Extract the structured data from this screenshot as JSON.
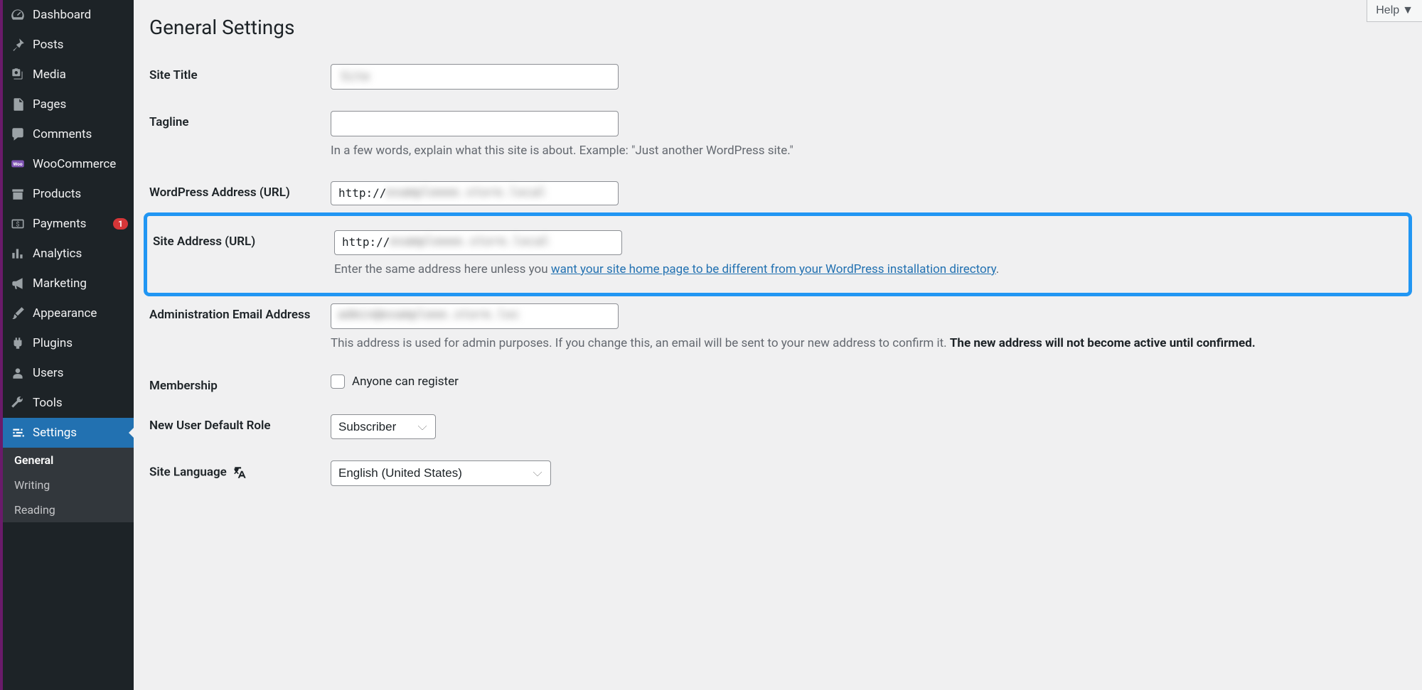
{
  "help_label": "Help",
  "page_title": "General Settings",
  "sidebar": {
    "dashboard": "Dashboard",
    "posts": "Posts",
    "media": "Media",
    "pages": "Pages",
    "comments": "Comments",
    "woocommerce": "WooCommerce",
    "products": "Products",
    "payments": "Payments",
    "payments_badge": "1",
    "analytics": "Analytics",
    "marketing": "Marketing",
    "appearance": "Appearance",
    "plugins": "Plugins",
    "users": "Users",
    "tools": "Tools",
    "settings": "Settings",
    "sub": {
      "general": "General",
      "writing": "Writing",
      "reading": "Reading"
    }
  },
  "fields": {
    "site_title": {
      "label": "Site Title",
      "value": ""
    },
    "tagline": {
      "label": "Tagline",
      "value": "",
      "description": "In a few words, explain what this site is about. Example: \"Just another WordPress site.\""
    },
    "wp_address": {
      "label": "WordPress Address (URL)",
      "value": "http://"
    },
    "site_address": {
      "label": "Site Address (URL)",
      "value": "http://",
      "desc_pre": "Enter the same address here unless you ",
      "desc_link": "want your site home page to be different from your WordPress installation directory",
      "desc_post": "."
    },
    "admin_email": {
      "label": "Administration Email Address",
      "value": "",
      "desc_normal": "This address is used for admin purposes. If you change this, an email will be sent to your new address to confirm it. ",
      "desc_strong": "The new address will not become active until confirmed."
    },
    "membership": {
      "label": "Membership",
      "option": "Anyone can register"
    },
    "default_role": {
      "label": "New User Default Role",
      "value": "Subscriber"
    },
    "site_language": {
      "label": "Site Language",
      "value": "English (United States)"
    }
  }
}
